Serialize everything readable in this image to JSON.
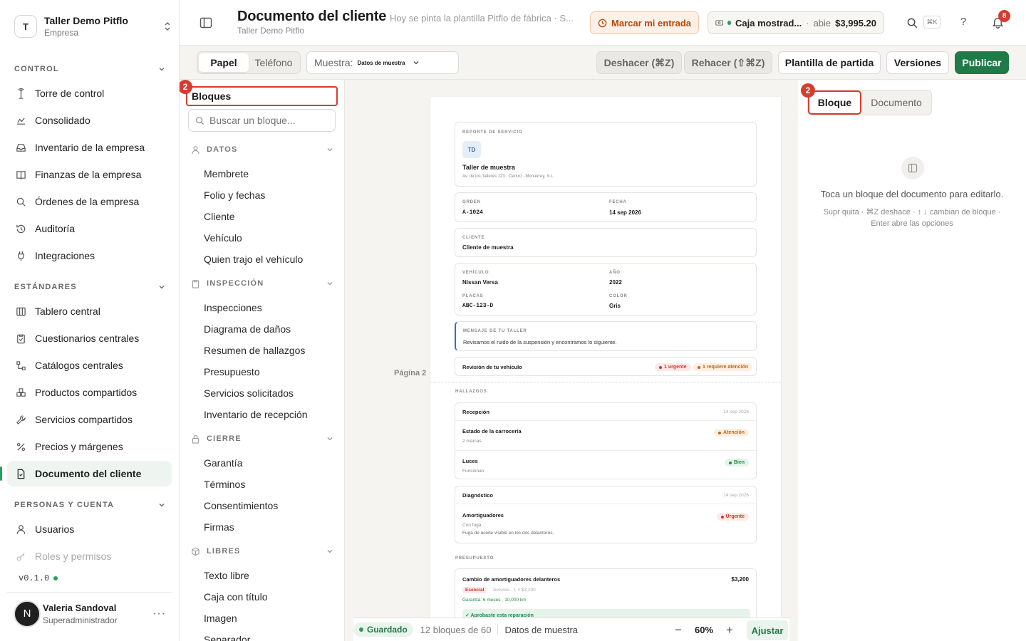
{
  "org": {
    "initial": "T",
    "name": "Taller Demo Pitflo",
    "type": "Empresa"
  },
  "sidebar": {
    "sections": [
      {
        "label": "CONTROL",
        "items": [
          {
            "label": "Torre de control",
            "icon": "tower-icon"
          },
          {
            "label": "Consolidado",
            "icon": "chart-icon"
          },
          {
            "label": "Inventario de la empresa",
            "icon": "inbox-icon"
          },
          {
            "label": "Finanzas de la empresa",
            "icon": "book-icon"
          },
          {
            "label": "Órdenes de la empresa",
            "icon": "search-icon"
          },
          {
            "label": "Auditoría",
            "icon": "history-icon"
          },
          {
            "label": "Integraciones",
            "icon": "plug-icon"
          }
        ]
      },
      {
        "label": "ESTÁNDARES",
        "items": [
          {
            "label": "Tablero central",
            "icon": "columns-icon"
          },
          {
            "label": "Cuestionarios centrales",
            "icon": "clipboard-icon"
          },
          {
            "label": "Catálogos centrales",
            "icon": "hierarchy-icon"
          },
          {
            "label": "Productos compartidos",
            "icon": "boxes-icon"
          },
          {
            "label": "Servicios compartidos",
            "icon": "wrench-icon"
          },
          {
            "label": "Precios y márgenes",
            "icon": "percent-icon"
          },
          {
            "label": "Documento del cliente",
            "icon": "document-icon"
          }
        ]
      },
      {
        "label": "PERSONAS Y CUENTA",
        "items": [
          {
            "label": "Usuarios",
            "icon": "user-icon"
          },
          {
            "label": "Roles y permisos",
            "icon": "key-icon"
          }
        ]
      }
    ],
    "version": "v0.1.0"
  },
  "user": {
    "initial": "N",
    "name": "Valeria Sandoval",
    "role": "Superadministrador",
    "more": "···"
  },
  "header": {
    "title": "Documento del cliente",
    "subtitle": "Taller Demo Pitflo",
    "tagline": "Hoy se pinta la plantilla Pitflo de fábrica · S...",
    "entry_button": "Marcar mi entrada",
    "cash": {
      "name": "Caja mostrad...",
      "sep": "·",
      "state": "abie",
      "amount": "$3,995.20"
    },
    "shortcut": "⌘K",
    "help": "?",
    "notifications": "8"
  },
  "toolbar": {
    "view_tabs": [
      "Papel",
      "Teléfono"
    ],
    "sample_label": "Muestra:",
    "sample_value": "Datos de muestra",
    "undo": "Deshacer (⌘Z)",
    "redo": "Rehacer (⇧⌘Z)",
    "template": "Plantilla de partida",
    "versions": "Versiones",
    "publish": "Publicar"
  },
  "blocks": {
    "badge": "2",
    "title": "Bloques",
    "search_placeholder": "Buscar un bloque...",
    "groups": [
      {
        "label": "DATOS",
        "icon": "user-icon",
        "items": [
          "Membrete",
          "Folio y fechas",
          "Cliente",
          "Vehículo",
          "Quien trajo el vehículo"
        ]
      },
      {
        "label": "INSPECCIÓN",
        "icon": "clipboard-icon",
        "items": [
          "Inspecciones",
          "Diagrama de daños",
          "Resumen de hallazgos",
          "Presupuesto",
          "Servicios solicitados",
          "Inventario de recepción"
        ]
      },
      {
        "label": "CIERRE",
        "icon": "lock-icon",
        "items": [
          "Garantía",
          "Términos",
          "Consentimientos",
          "Firmas"
        ]
      },
      {
        "label": "LIBRES",
        "icon": "cube-icon",
        "items": [
          "Texto libre",
          "Caja con título",
          "Imagen",
          "Separador"
        ]
      }
    ]
  },
  "document": {
    "page_label": "Página 2",
    "header_card": {
      "label": "REPORTE DE SERVICIO",
      "logo": "TD",
      "shop": "Taller de muestra",
      "address": "Av. de los Talleres 123 · Centro · Monterrey, N.L."
    },
    "folio": {
      "order_label": "ORDEN",
      "order": "A-1024",
      "date_label": "FECHA",
      "date": "14 sep 2026"
    },
    "client": {
      "label": "CLIENTE",
      "value": "Cliente de muestra"
    },
    "vehicle": {
      "vehicle_label": "VEHÍCULO",
      "vehicle": "Nissan Versa",
      "year_label": "AÑO",
      "year": "2022",
      "plates_label": "PLACAS",
      "plates": "ABC-123-D",
      "color_label": "COLOR",
      "color": "Gris"
    },
    "message": {
      "label": "MENSAJE DE TU TALLER",
      "text": "Revisamos el ruido de la suspensión y encontramos lo siguiente."
    },
    "review": {
      "label": "Revisión de tu vehículo",
      "urgent": "1 urgente",
      "attention": "1 requiere atención"
    },
    "findings_label": "HALLAZGOS",
    "findings": [
      {
        "title": "Recepción",
        "date": "14 sep 2026",
        "rows": [
          {
            "name": "Estado de la carrocería",
            "note": "2 marcas",
            "status": "Atención"
          },
          {
            "name": "Luces",
            "note": "Funcionan",
            "status": "Bien"
          }
        ]
      },
      {
        "title": "Diagnóstico",
        "date": "14 sep 2026",
        "rows": [
          {
            "name": "Amortiguadores",
            "note": "Con fuga",
            "note2": "Fuga de aceite visible en los dos delanteros.",
            "status": "Urgente"
          }
        ]
      }
    ],
    "budget_label": "PRESUPUESTO",
    "budget": {
      "title": "Cambio de amortiguadores delanteros",
      "price": "$3,200",
      "tag": "Esencial",
      "detail": "Servicio · 1 × $3,200",
      "warranty": "Garantía: 6 meses · 10,000 km",
      "approved": "✓ Aprobaste esta reparación"
    }
  },
  "status_bar": {
    "saved": "Guardado",
    "blocks_count": "12 bloques de 60",
    "sample": "Datos de muestra",
    "zoom": "60%",
    "zoom_out": "−",
    "zoom_in": "+",
    "fit": "Ajustar"
  },
  "inspector": {
    "badge": "2",
    "tabs": [
      "Bloque",
      "Documento"
    ],
    "empty_title": "Toca un bloque del documento para editarlo.",
    "empty_hint": "Supr quita · ⌘Z deshace · ↑ ↓ cambian de bloque · Enter abre las opciones"
  },
  "colors": {
    "accent": "#1f7a48",
    "highlight": "#d63c30",
    "warning": "#b5470e"
  }
}
